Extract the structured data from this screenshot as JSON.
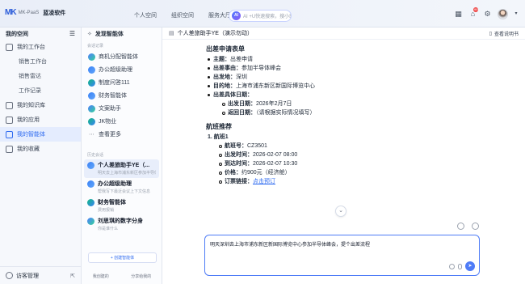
{
  "brand": {
    "logo": "MK",
    "sub": "MK-PaaS",
    "name": "蓝凌软件"
  },
  "nav": {
    "tabs": [
      "个人空间",
      "组织空间",
      "服务大厅"
    ]
  },
  "search": {
    "placeholder": "AI +U快速搜索，搜小助"
  },
  "topbar": {
    "badge": "99"
  },
  "sidebar": {
    "title": "我的空间",
    "items": [
      {
        "label": "我的工作台"
      },
      {
        "label": "销售工作台"
      },
      {
        "label": "销售雷达"
      },
      {
        "label": "工作记录"
      },
      {
        "label": "我的知识库"
      },
      {
        "label": "我的应用"
      },
      {
        "label": "我的智能体"
      },
      {
        "label": "我的收藏"
      }
    ],
    "footer": "访客管理"
  },
  "agents": {
    "title": "发现智能体",
    "recent_label": "会话记录",
    "list": [
      "商机分配智能体",
      "办公超级助理",
      "制度问答111",
      "财务智能体",
      "文案助手",
      "JK物业",
      "查看更多"
    ],
    "history_label": "历史会话",
    "history": [
      {
        "title": "个人差旅助手YE（...",
        "sub": "明天去上海市浦东新区参加半导体峰会"
      },
      {
        "title": "办公超级助理",
        "sub": "帮我写下最近会议上下文信息"
      },
      {
        "title": "财务智能体",
        "sub": "费用报销"
      },
      {
        "title": "刘思琪的数字分身",
        "sub": "你是谁什么"
      }
    ],
    "create": "+ 创建智能体",
    "foot_left": "我创建的",
    "foot_right": "分享给我的"
  },
  "main": {
    "title": "个人差旅助手YE（演示勿动）",
    "guide": "查看说明书",
    "form_title": "出差申请表单",
    "fields": [
      {
        "k": "主题：",
        "v": "出差申请"
      },
      {
        "k": "出差事由：",
        "v": "参加半导体峰会"
      },
      {
        "k": "出发地：",
        "v": "深圳"
      },
      {
        "k": "目的地：",
        "v": "上海市浦东新区新国际博览中心"
      },
      {
        "k": "出差具体日期：",
        "v": ""
      }
    ],
    "dates": [
      {
        "k": "出发日期：",
        "v": "2026年2月7日"
      },
      {
        "k": "返回日期：",
        "v": "（请根据实际情况填写）"
      }
    ],
    "flight_title": "航班推荐",
    "flight_label": "1.  航班1",
    "flight": [
      {
        "k": "航班号：",
        "v": "CZ3501"
      },
      {
        "k": "出发时间：",
        "v": "2026-02-07 08:00"
      },
      {
        "k": "到达时间：",
        "v": "2026-02-07 10:30"
      },
      {
        "k": "价格：",
        "v": "约900元（经济舱）"
      },
      {
        "k": "订票链接：",
        "v": ""
      }
    ],
    "book_link": "点击预订",
    "input_value": "明天深圳去上海市浦东新区新国际博览中心参加半导体峰会，提个出差流程"
  }
}
